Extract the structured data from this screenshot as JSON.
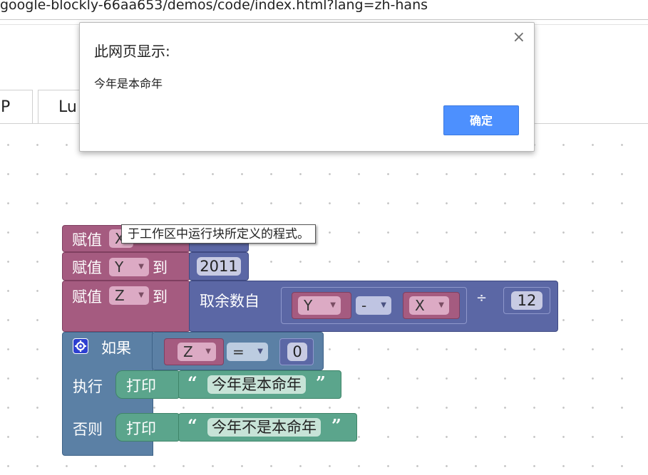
{
  "browser": {
    "url": "google-blockly-66aa653/demos/code/index.html?lang=zh-hans"
  },
  "tabs": [
    {
      "label": "P"
    },
    {
      "label": "Lu"
    }
  ],
  "tooltip": {
    "text": "于工作区中运行块所定义的程式。"
  },
  "dialog": {
    "title": "此网页显示:",
    "message": "今年是本命年",
    "ok_label": "确定",
    "close_symbol": "×"
  },
  "blocks": {
    "set1": {
      "label": "赋值",
      "var": "X"
    },
    "set2": {
      "label": "赋值",
      "var": "Y",
      "to": "到",
      "value": "2011"
    },
    "set3": {
      "label": "赋值",
      "var": "Z",
      "to": "到",
      "modulo_label": "取余数自",
      "left_var": "Y",
      "op": "-",
      "right_var": "X",
      "divide": "÷",
      "divisor": "12"
    },
    "if_block": {
      "if_label": "如果",
      "cond_var": "Z",
      "cond_op": "=",
      "cond_value": "0",
      "do_label": "执行",
      "else_label": "否则",
      "print_label": "打印",
      "print_then": "今年是本命年",
      "print_else": "今年不是本命年",
      "open_quote": "“",
      "close_quote": "”"
    }
  },
  "colors": {
    "variables": "#a55b80",
    "math": "#5b67a5",
    "logic": "#5b80a5",
    "text": "#5ba58c",
    "ok_button": "#4d90fe"
  }
}
